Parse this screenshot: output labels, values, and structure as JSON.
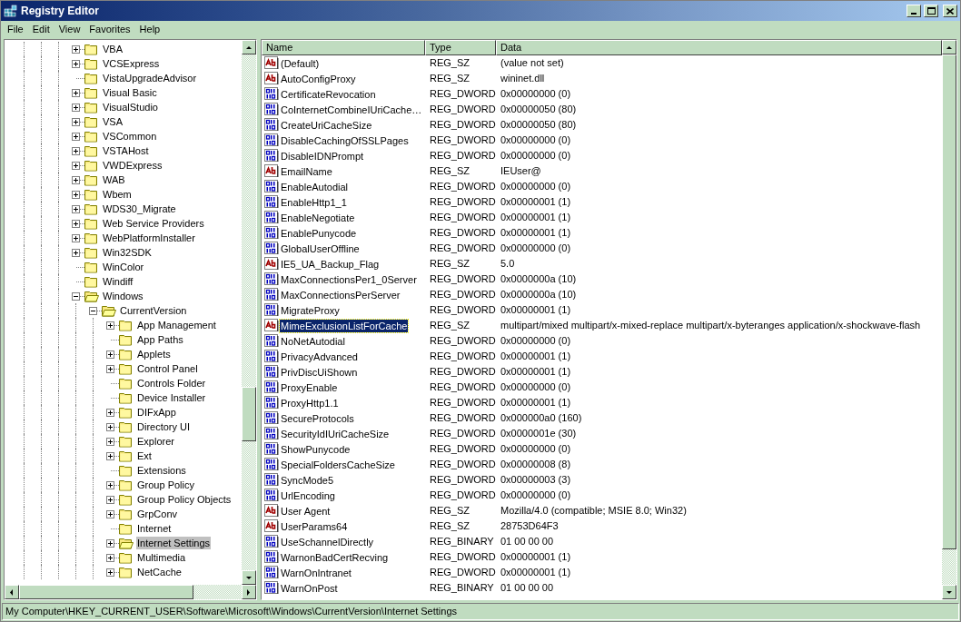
{
  "window": {
    "title": "Registry Editor"
  },
  "menu": [
    "File",
    "Edit",
    "View",
    "Favorites",
    "Help"
  ],
  "tree": [
    {
      "label": "VBA",
      "has_children": true,
      "expanded": false,
      "selected": false
    },
    {
      "label": "VCSExpress",
      "has_children": true,
      "expanded": false,
      "selected": false
    },
    {
      "label": "VistaUpgradeAdvisor",
      "has_children": false,
      "expanded": false,
      "selected": false
    },
    {
      "label": "Visual Basic",
      "has_children": true,
      "expanded": false,
      "selected": false
    },
    {
      "label": "VisualStudio",
      "has_children": true,
      "expanded": false,
      "selected": false
    },
    {
      "label": "VSA",
      "has_children": true,
      "expanded": false,
      "selected": false
    },
    {
      "label": "VSCommon",
      "has_children": true,
      "expanded": false,
      "selected": false
    },
    {
      "label": "VSTAHost",
      "has_children": true,
      "expanded": false,
      "selected": false
    },
    {
      "label": "VWDExpress",
      "has_children": true,
      "expanded": false,
      "selected": false
    },
    {
      "label": "WAB",
      "has_children": true,
      "expanded": false,
      "selected": false
    },
    {
      "label": "Wbem",
      "has_children": true,
      "expanded": false,
      "selected": false
    },
    {
      "label": "WDS30_Migrate",
      "has_children": true,
      "expanded": false,
      "selected": false
    },
    {
      "label": "Web Service Providers",
      "has_children": true,
      "expanded": false,
      "selected": false
    },
    {
      "label": "WebPlatformInstaller",
      "has_children": true,
      "expanded": false,
      "selected": false
    },
    {
      "label": "Win32SDK",
      "has_children": true,
      "expanded": false,
      "selected": false
    },
    {
      "label": "WinColor",
      "has_children": false,
      "expanded": false,
      "selected": false
    },
    {
      "label": "Windiff",
      "has_children": false,
      "expanded": false,
      "selected": false
    },
    {
      "label": "Windows",
      "has_children": true,
      "expanded": true,
      "selected": false,
      "children": [
        {
          "label": "CurrentVersion",
          "has_children": true,
          "expanded": true,
          "selected": false,
          "children": [
            {
              "label": "App Management",
              "has_children": true,
              "expanded": false,
              "selected": false
            },
            {
              "label": "App Paths",
              "has_children": false,
              "expanded": false,
              "selected": false
            },
            {
              "label": "Applets",
              "has_children": true,
              "expanded": false,
              "selected": false
            },
            {
              "label": "Control Panel",
              "has_children": true,
              "expanded": false,
              "selected": false
            },
            {
              "label": "Controls Folder",
              "has_children": false,
              "expanded": false,
              "selected": false
            },
            {
              "label": "Device Installer",
              "has_children": false,
              "expanded": false,
              "selected": false
            },
            {
              "label": "DIFxApp",
              "has_children": true,
              "expanded": false,
              "selected": false
            },
            {
              "label": "Directory UI",
              "has_children": true,
              "expanded": false,
              "selected": false
            },
            {
              "label": "Explorer",
              "has_children": true,
              "expanded": false,
              "selected": false
            },
            {
              "label": "Ext",
              "has_children": true,
              "expanded": false,
              "selected": false
            },
            {
              "label": "Extensions",
              "has_children": false,
              "expanded": false,
              "selected": false
            },
            {
              "label": "Group Policy",
              "has_children": true,
              "expanded": false,
              "selected": false
            },
            {
              "label": "Group Policy Objects",
              "has_children": true,
              "expanded": false,
              "selected": false
            },
            {
              "label": "GrpConv",
              "has_children": true,
              "expanded": false,
              "selected": false
            },
            {
              "label": "Internet",
              "has_children": false,
              "expanded": false,
              "selected": false
            },
            {
              "label": "Internet Settings",
              "has_children": true,
              "expanded": false,
              "selected": true
            },
            {
              "label": "Multimedia",
              "has_children": true,
              "expanded": false,
              "selected": false
            },
            {
              "label": "NetCache",
              "has_children": true,
              "expanded": false,
              "selected": false
            }
          ]
        }
      ]
    }
  ],
  "table": {
    "columns": [
      "Name",
      "Type",
      "Data"
    ],
    "rows": [
      {
        "kind": "string",
        "name": "(Default)",
        "type": "REG_SZ",
        "data": "(value not set)",
        "selected": false
      },
      {
        "kind": "string",
        "name": "AutoConfigProxy",
        "type": "REG_SZ",
        "data": "wininet.dll",
        "selected": false
      },
      {
        "kind": "binary",
        "name": "CertificateRevocation",
        "type": "REG_DWORD",
        "data": "0x00000000 (0)",
        "selected": false
      },
      {
        "kind": "binary",
        "name": "CoInternetCombineIUriCache…",
        "type": "REG_DWORD",
        "data": "0x00000050 (80)",
        "selected": false
      },
      {
        "kind": "binary",
        "name": "CreateUriCacheSize",
        "type": "REG_DWORD",
        "data": "0x00000050 (80)",
        "selected": false
      },
      {
        "kind": "binary",
        "name": "DisableCachingOfSSLPages",
        "type": "REG_DWORD",
        "data": "0x00000000 (0)",
        "selected": false
      },
      {
        "kind": "binary",
        "name": "DisableIDNPrompt",
        "type": "REG_DWORD",
        "data": "0x00000000 (0)",
        "selected": false
      },
      {
        "kind": "string",
        "name": "EmailName",
        "type": "REG_SZ",
        "data": "IEUser@",
        "selected": false
      },
      {
        "kind": "binary",
        "name": "EnableAutodial",
        "type": "REG_DWORD",
        "data": "0x00000000 (0)",
        "selected": false
      },
      {
        "kind": "binary",
        "name": "EnableHttp1_1",
        "type": "REG_DWORD",
        "data": "0x00000001 (1)",
        "selected": false
      },
      {
        "kind": "binary",
        "name": "EnableNegotiate",
        "type": "REG_DWORD",
        "data": "0x00000001 (1)",
        "selected": false
      },
      {
        "kind": "binary",
        "name": "EnablePunycode",
        "type": "REG_DWORD",
        "data": "0x00000001 (1)",
        "selected": false
      },
      {
        "kind": "binary",
        "name": "GlobalUserOffline",
        "type": "REG_DWORD",
        "data": "0x00000000 (0)",
        "selected": false
      },
      {
        "kind": "string",
        "name": "IE5_UA_Backup_Flag",
        "type": "REG_SZ",
        "data": "5.0",
        "selected": false
      },
      {
        "kind": "binary",
        "name": "MaxConnectionsPer1_0Server",
        "type": "REG_DWORD",
        "data": "0x0000000a (10)",
        "selected": false
      },
      {
        "kind": "binary",
        "name": "MaxConnectionsPerServer",
        "type": "REG_DWORD",
        "data": "0x0000000a (10)",
        "selected": false
      },
      {
        "kind": "binary",
        "name": "MigrateProxy",
        "type": "REG_DWORD",
        "data": "0x00000001 (1)",
        "selected": false
      },
      {
        "kind": "string",
        "name": "MimeExclusionListForCache",
        "type": "REG_SZ",
        "data": "multipart/mixed multipart/x-mixed-replace multipart/x-byteranges application/x-shockwave-flash",
        "selected": true
      },
      {
        "kind": "binary",
        "name": "NoNetAutodial",
        "type": "REG_DWORD",
        "data": "0x00000000 (0)",
        "selected": false
      },
      {
        "kind": "binary",
        "name": "PrivacyAdvanced",
        "type": "REG_DWORD",
        "data": "0x00000001 (1)",
        "selected": false
      },
      {
        "kind": "binary",
        "name": "PrivDiscUiShown",
        "type": "REG_DWORD",
        "data": "0x00000001 (1)",
        "selected": false
      },
      {
        "kind": "binary",
        "name": "ProxyEnable",
        "type": "REG_DWORD",
        "data": "0x00000000 (0)",
        "selected": false
      },
      {
        "kind": "binary",
        "name": "ProxyHttp1.1",
        "type": "REG_DWORD",
        "data": "0x00000001 (1)",
        "selected": false
      },
      {
        "kind": "binary",
        "name": "SecureProtocols",
        "type": "REG_DWORD",
        "data": "0x000000a0 (160)",
        "selected": false
      },
      {
        "kind": "binary",
        "name": "SecurityIdIUriCacheSize",
        "type": "REG_DWORD",
        "data": "0x0000001e (30)",
        "selected": false
      },
      {
        "kind": "binary",
        "name": "ShowPunycode",
        "type": "REG_DWORD",
        "data": "0x00000000 (0)",
        "selected": false
      },
      {
        "kind": "binary",
        "name": "SpecialFoldersCacheSize",
        "type": "REG_DWORD",
        "data": "0x00000008 (8)",
        "selected": false
      },
      {
        "kind": "binary",
        "name": "SyncMode5",
        "type": "REG_DWORD",
        "data": "0x00000003 (3)",
        "selected": false
      },
      {
        "kind": "binary",
        "name": "UrlEncoding",
        "type": "REG_DWORD",
        "data": "0x00000000 (0)",
        "selected": false
      },
      {
        "kind": "string",
        "name": "User Agent",
        "type": "REG_SZ",
        "data": "Mozilla/4.0 (compatible; MSIE 8.0; Win32)",
        "selected": false
      },
      {
        "kind": "string",
        "name": "UserParams64",
        "type": "REG_SZ",
        "data": "28753D64F3",
        "selected": false
      },
      {
        "kind": "binary",
        "name": "UseSchannelDirectly",
        "type": "REG_BINARY",
        "data": "01 00 00 00",
        "selected": false
      },
      {
        "kind": "binary",
        "name": "WarnonBadCertRecving",
        "type": "REG_DWORD",
        "data": "0x00000001 (1)",
        "selected": false
      },
      {
        "kind": "binary",
        "name": "WarnOnIntranet",
        "type": "REG_DWORD",
        "data": "0x00000001 (1)",
        "selected": false
      },
      {
        "kind": "binary",
        "name": "WarnOnPost",
        "type": "REG_BINARY",
        "data": "01 00 00 00",
        "selected": false
      }
    ]
  },
  "status_bar": "My Computer\\HKEY_CURRENT_USER\\Software\\Microsoft\\Windows\\CurrentVersion\\Internet Settings"
}
